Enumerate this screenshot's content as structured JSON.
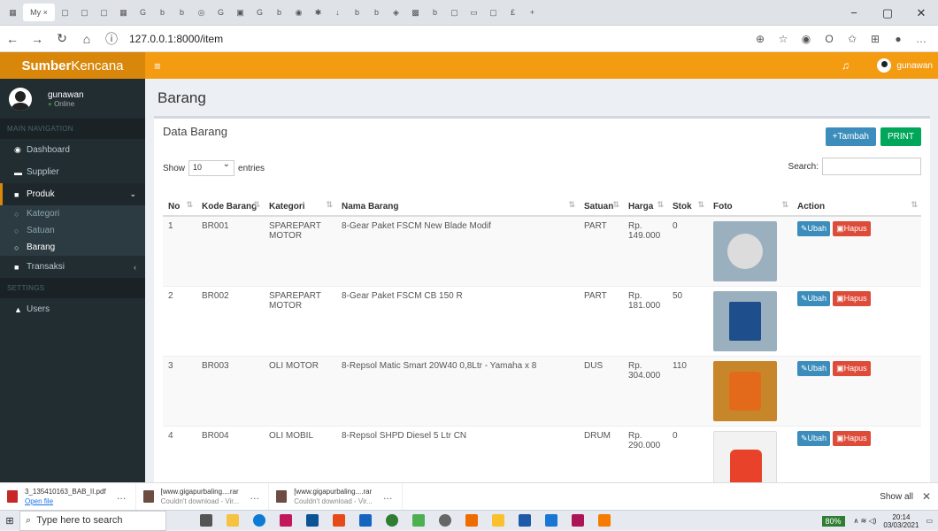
{
  "browser": {
    "active_tab_label": "My",
    "url": "127.0.0.1:8000/item"
  },
  "app": {
    "brand_bold": "Sumber",
    "brand_rest": "Kencana",
    "user_name": "gunawan",
    "user_status": "Online",
    "top_user": "gunawan"
  },
  "sidebar": {
    "main_header": "MAIN NAVIGATION",
    "dashboard": "Dashboard",
    "supplier": "Supplier",
    "produk": "Produk",
    "kategori": "Kategori",
    "satuan": "Satuan",
    "barang": "Barang",
    "transaksi": "Transaksi",
    "settings_header": "SETTINGS",
    "users": "Users"
  },
  "page": {
    "title": "Barang",
    "box_title": "Data Barang",
    "tambah": "+Tambah",
    "print": "PRINT",
    "show": "Show",
    "entries_value": "10",
    "entries": "entries",
    "search": "Search:"
  },
  "table": {
    "headers": [
      "No",
      "Kode Barang",
      "Kategori",
      "Nama Barang",
      "Satuan",
      "Harga",
      "Stok",
      "Foto",
      "Action"
    ],
    "rows": [
      {
        "no": "1",
        "kode": "BR001",
        "kategori": "SPAREPART MOTOR",
        "nama": "8-Gear Paket FSCM New Blade Modif",
        "satuan": "PART",
        "harga": "Rp. 149.000",
        "stok": "0"
      },
      {
        "no": "2",
        "kode": "BR002",
        "kategori": "SPAREPART MOTOR",
        "nama": "8-Gear Paket FSCM CB 150 R",
        "satuan": "PART",
        "harga": "Rp. 181.000",
        "stok": "50"
      },
      {
        "no": "3",
        "kode": "BR003",
        "kategori": "OLI MOTOR",
        "nama": "8-Repsol Matic Smart 20W40 0,8Ltr - Yamaha x 8",
        "satuan": "DUS",
        "harga": "Rp. 304.000",
        "stok": "110"
      },
      {
        "no": "4",
        "kode": "BR004",
        "kategori": "OLI MOBIL",
        "nama": "8-Repsol SHPD Diesel 5 Ltr CN",
        "satuan": "DRUM",
        "harga": "Rp. 290.000",
        "stok": "0"
      }
    ],
    "ubah": "Ubah",
    "hapus": "Hapus"
  },
  "downloads": [
    {
      "name": "3_135410163_BAB_II.pdf",
      "status": "Open file"
    },
    {
      "name": "[www.gigapurbaling....rar",
      "status": "Couldn't download - Vir..."
    },
    {
      "name": "[www.gigapurbaling....rar",
      "status": "Couldn't download - Vir..."
    }
  ],
  "download_showall": "Show all",
  "taskbar": {
    "search_placeholder": "Type here to search",
    "battery": "80%",
    "time": "20:14",
    "date": "03/03/2021"
  }
}
